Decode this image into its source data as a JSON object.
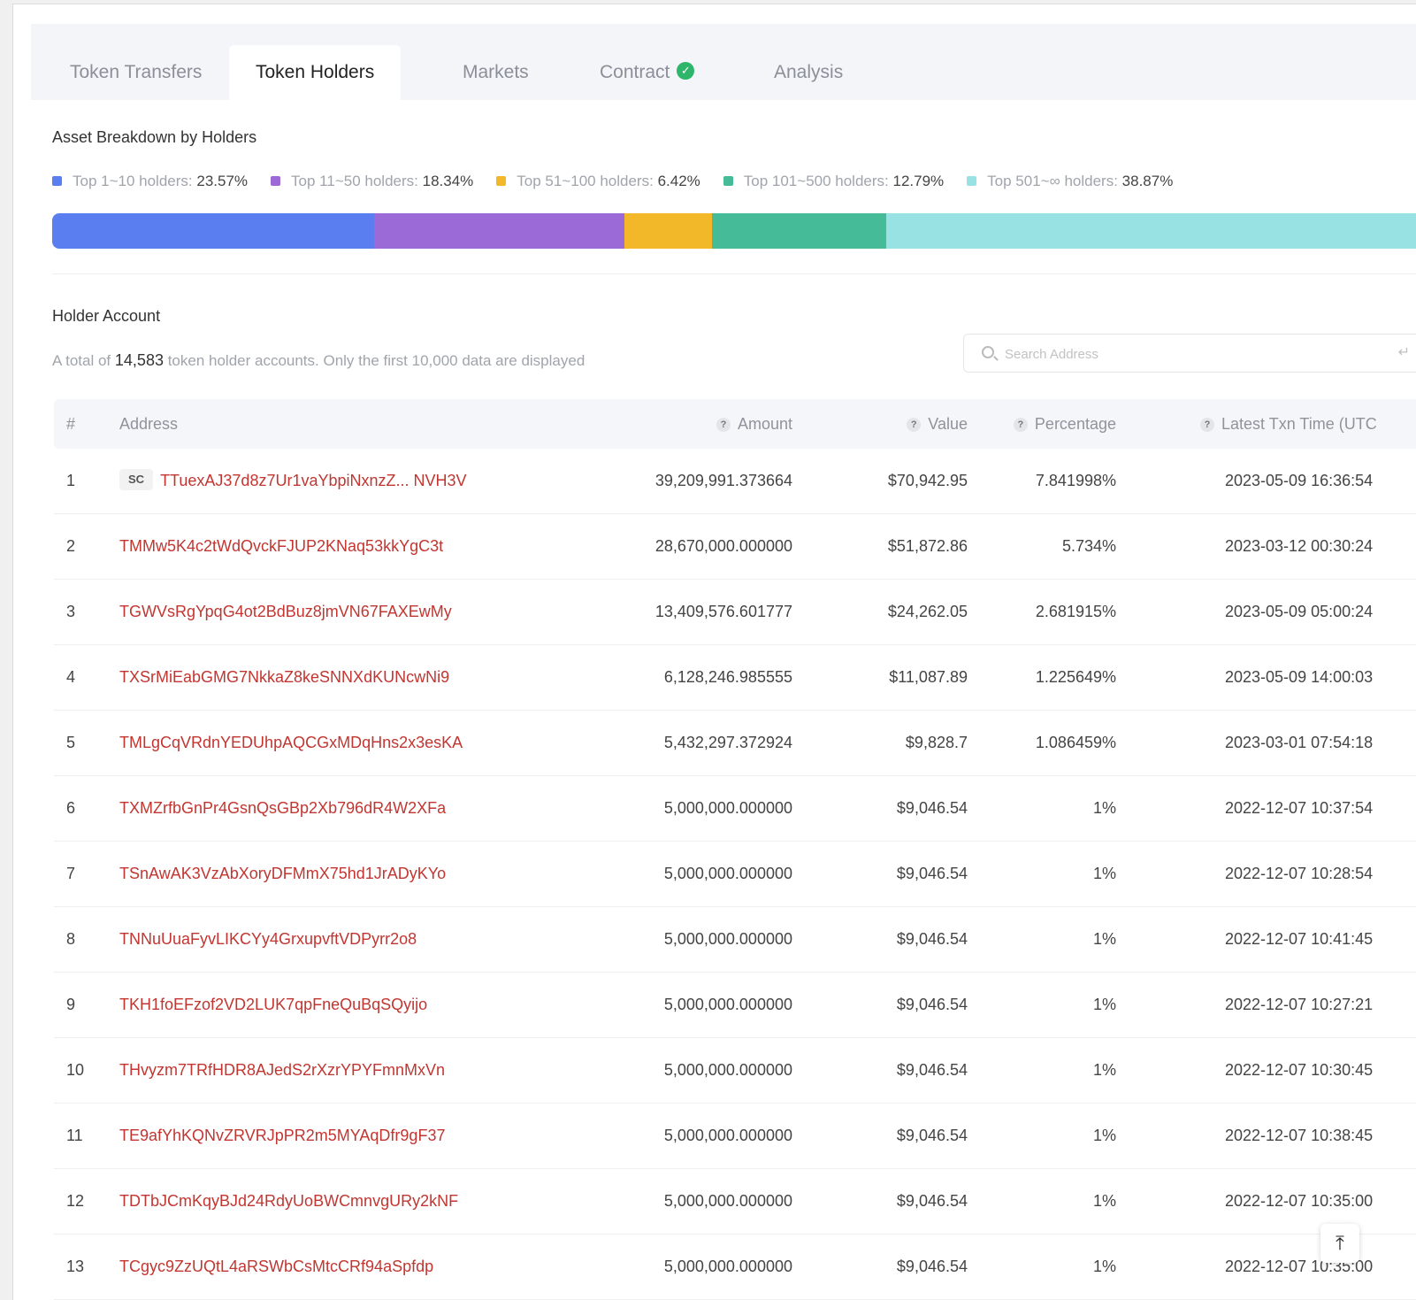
{
  "tabs": [
    {
      "label": "Token Transfers",
      "active": false
    },
    {
      "label": "Token Holders",
      "active": true
    },
    {
      "label": "Markets",
      "active": false
    },
    {
      "label": "Contract",
      "active": false,
      "verified_icon": "check-circle-icon",
      "verified_color": "#2db56a"
    },
    {
      "label": "Analysis",
      "active": false
    }
  ],
  "breakdown": {
    "title": "Asset Breakdown by Holders",
    "segments": [
      {
        "label": "Top 1~10 holders:",
        "value": "23.57%",
        "percent": 23.57,
        "color": "#5a7ef0"
      },
      {
        "label": "Top 11~50 holders:",
        "value": "18.34%",
        "percent": 18.34,
        "color": "#9c6ad6"
      },
      {
        "label": "Top 51~100 holders:",
        "value": "6.42%",
        "percent": 6.42,
        "color": "#f2b829"
      },
      {
        "label": "Top 101~500 holders:",
        "value": "12.79%",
        "percent": 12.79,
        "color": "#45bb98"
      },
      {
        "label": "Top 501~∞ holders:",
        "value": "38.87%",
        "percent": 38.87,
        "color": "#99e2e4"
      }
    ]
  },
  "holders": {
    "title": "Holder Account",
    "total_prefix": "A total of",
    "total_count": "14,583",
    "total_suffix": "token holder accounts. Only the first 10,000 data are displayed",
    "search_placeholder": "Search Address",
    "columns": {
      "index": "#",
      "address": "Address",
      "amount": "Amount",
      "value": "Value",
      "percentage": "Percentage",
      "latest_time": "Latest Txn Time (UTC"
    },
    "rows": [
      {
        "idx": "1",
        "badge": "SC",
        "address": "TTuexAJ37d8z7Ur1vaYbpiNxnzZ... NVH3V",
        "amount": "39,209,991.373664",
        "value": "$70,942.95",
        "percentage": "7.841998%",
        "time": "2023-05-09 16:36:54"
      },
      {
        "idx": "2",
        "address": "TMMw5K4c2tWdQvckFJUP2KNaq53kkYgC3t",
        "amount": "28,670,000.000000",
        "value": "$51,872.86",
        "percentage": "5.734%",
        "time": "2023-03-12 00:30:24"
      },
      {
        "idx": "3",
        "address": "TGWVsRgYpqG4ot2BdBuz8jmVN67FAXEwMy",
        "amount": "13,409,576.601777",
        "value": "$24,262.05",
        "percentage": "2.681915%",
        "time": "2023-05-09 05:00:24"
      },
      {
        "idx": "4",
        "address": "TXSrMiEabGMG7NkkaZ8keSNNXdKUNcwNi9",
        "amount": "6,128,246.985555",
        "value": "$11,087.89",
        "percentage": "1.225649%",
        "time": "2023-05-09 14:00:03"
      },
      {
        "idx": "5",
        "address": "TMLgCqVRdnYEDUhpAQCGxMDqHns2x3esKA",
        "amount": "5,432,297.372924",
        "value": "$9,828.7",
        "percentage": "1.086459%",
        "time": "2023-03-01 07:54:18"
      },
      {
        "idx": "6",
        "address": "TXMZrfbGnPr4GsnQsGBp2Xb796dR4W2XFa",
        "amount": "5,000,000.000000",
        "value": "$9,046.54",
        "percentage": "1%",
        "time": "2022-12-07 10:37:54"
      },
      {
        "idx": "7",
        "address": "TSnAwAK3VzAbXoryDFMmX75hd1JrADyKYo",
        "amount": "5,000,000.000000",
        "value": "$9,046.54",
        "percentage": "1%",
        "time": "2022-12-07 10:28:54"
      },
      {
        "idx": "8",
        "address": "TNNuUuaFyvLIKCYy4GrxupvftVDPyrr2o8",
        "amount": "5,000,000.000000",
        "value": "$9,046.54",
        "percentage": "1%",
        "time": "2022-12-07 10:41:45"
      },
      {
        "idx": "9",
        "address": "TKH1foEFzof2VD2LUK7qpFneQuBqSQyijo",
        "amount": "5,000,000.000000",
        "value": "$9,046.54",
        "percentage": "1%",
        "time": "2022-12-07 10:27:21"
      },
      {
        "idx": "10",
        "address": "THvyzm7TRfHDR8AJedS2rXzrYPYFmnMxVn",
        "amount": "5,000,000.000000",
        "value": "$9,046.54",
        "percentage": "1%",
        "time": "2022-12-07 10:30:45"
      },
      {
        "idx": "11",
        "address": "TE9afYhKQNvZRVRJpPR2m5MYAqDfr9gF37",
        "amount": "5,000,000.000000",
        "value": "$9,046.54",
        "percentage": "1%",
        "time": "2022-12-07 10:38:45"
      },
      {
        "idx": "12",
        "address": "TDTbJCmKqyBJd24RdyUoBWCmnvgURy2kNF",
        "amount": "5,000,000.000000",
        "value": "$9,046.54",
        "percentage": "1%",
        "time": "2022-12-07 10:35:00"
      },
      {
        "idx": "13",
        "address": "TCgyc9ZzUQtL4aRSWbCsMtcCRf94aSpfdp",
        "amount": "5,000,000.000000",
        "value": "$9,046.54",
        "percentage": "1%",
        "time": "2022-12-07 10:35:00"
      }
    ]
  },
  "scroll_top_icon": "arrow-to-top-icon"
}
